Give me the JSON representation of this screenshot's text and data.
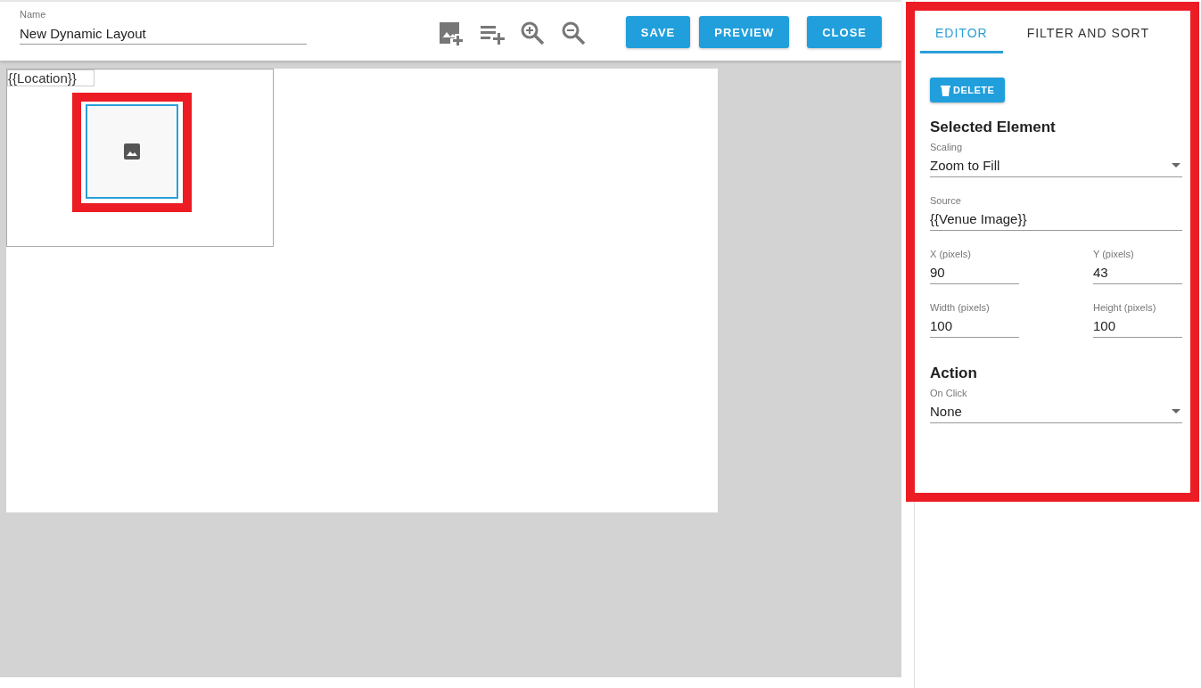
{
  "name_field": {
    "label": "Name",
    "value": "New Dynamic Layout"
  },
  "header_buttons": [
    {
      "label": "SAVE"
    },
    {
      "label": "PREVIEW"
    },
    {
      "label": "CLOSE"
    }
  ],
  "canvas": {
    "elements": [
      {
        "kind": "text",
        "text": "{{Location}}",
        "selected": false
      },
      {
        "kind": "image",
        "selected": true
      }
    ]
  },
  "tabs": [
    {
      "label": "EDITOR",
      "selected": true
    },
    {
      "label": "FILTER AND SORT",
      "selected": false
    }
  ],
  "delete_button": {
    "label": "DELETE"
  },
  "sections": [
    {
      "title": "Selected Element",
      "rows": [
        [
          {
            "kind": "select",
            "label": "Scaling",
            "value": "Zoom to Fill"
          }
        ],
        [
          {
            "kind": "text",
            "label": "Source",
            "value": "{{Venue Image}}"
          }
        ],
        [
          {
            "kind": "text",
            "label": "X (pixels)",
            "value": "90"
          },
          {
            "kind": "text",
            "label": "Y (pixels)",
            "value": "43"
          }
        ],
        [
          {
            "kind": "text",
            "label": "Width (pixels)",
            "value": "100"
          },
          {
            "kind": "text",
            "label": "Height (pixels)",
            "value": "100"
          }
        ]
      ]
    },
    {
      "title": "Action",
      "rows": [
        [
          {
            "kind": "select",
            "label": "On Click",
            "value": "None"
          }
        ]
      ]
    }
  ]
}
